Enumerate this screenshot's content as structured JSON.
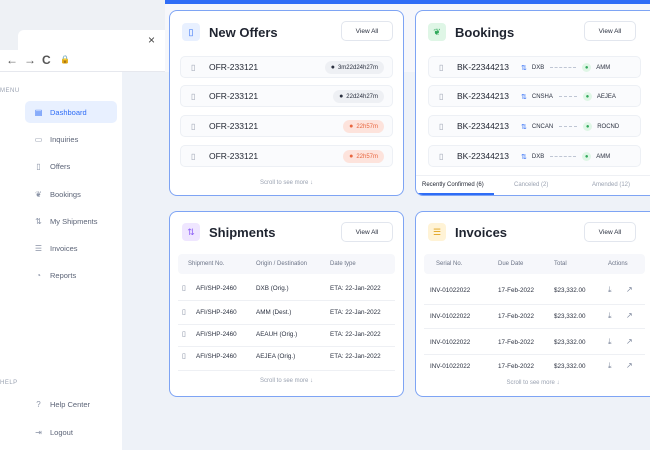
{
  "browser": {
    "tab_close": "×",
    "back": "←",
    "forward": "→",
    "reload": "C",
    "lock": "🔒"
  },
  "sidebar": {
    "menu_label": "MENU",
    "help_label": "HELP",
    "items": [
      {
        "label": "Dashboard",
        "icon": "dashboard-icon",
        "active": true
      },
      {
        "label": "Inquiries",
        "icon": "chat-icon",
        "active": false
      },
      {
        "label": "Offers",
        "icon": "document-icon",
        "active": false
      },
      {
        "label": "Bookings",
        "icon": "leaf-icon",
        "active": false
      },
      {
        "label": "My Shipments",
        "icon": "transfer-icon",
        "active": false
      },
      {
        "label": "Invoices",
        "icon": "list-icon",
        "active": false
      },
      {
        "label": "Reports",
        "icon": "pie-chart-icon",
        "active": false
      }
    ],
    "help_items": [
      {
        "label": "Help Center",
        "icon": "help-icon"
      },
      {
        "label": "Logout",
        "icon": "logout-icon"
      }
    ]
  },
  "offers": {
    "title": "New Offers",
    "view_all": "View All",
    "scroll_more": "Scroll to see more",
    "rows": [
      {
        "id": "OFR-233121",
        "timer": "3m22d24h27m",
        "urgent": false
      },
      {
        "id": "OFR-233121",
        "timer": "22d24h27m",
        "urgent": false
      },
      {
        "id": "OFR-233121",
        "timer": "22h57m",
        "urgent": true
      },
      {
        "id": "OFR-233121",
        "timer": "22h57m",
        "urgent": true
      }
    ]
  },
  "bookings": {
    "title": "Bookings",
    "view_all": "View All",
    "rows": [
      {
        "id": "BK-22344213",
        "from": "DXB",
        "to": "AMM"
      },
      {
        "id": "BK-22344213",
        "from": "CNSHA",
        "to": "AEJEA"
      },
      {
        "id": "BK-22344213",
        "from": "CNCAN",
        "to": "ROCND"
      },
      {
        "id": "BK-22344213",
        "from": "DXB",
        "to": "AMM"
      }
    ],
    "tabs": [
      "Recently Confirmed (6)",
      "Canceled (2)",
      "Amended (12)"
    ]
  },
  "shipments": {
    "title": "Shipments",
    "view_all": "View All",
    "scroll_more": "Scroll to see more",
    "headers": [
      "Shipment No.",
      "Origin / Destination",
      "Date type"
    ],
    "rows": [
      [
        "AFI/SHP-2460",
        "DXB (Orig.)",
        "ETA: 22-Jan-2022"
      ],
      [
        "AFI/SHP-2460",
        "AMM (Dest.)",
        "ETA: 22-Jan-2022"
      ],
      [
        "AFI/SHP-2460",
        "AEAUH (Orig.)",
        "ETA: 22-Jan-2022"
      ],
      [
        "AFI/SHP-2460",
        "AEJEA (Orig.)",
        "ETA: 22-Jan-2022"
      ]
    ]
  },
  "invoices": {
    "title": "Invoices",
    "view_all": "View All",
    "scroll_more": "Scroll to see more",
    "headers": [
      "Serial No.",
      "Due Date",
      "Total",
      "Actions"
    ],
    "rows": [
      [
        "INV-01022022",
        "17-Feb-2022",
        "$23,332.00"
      ],
      [
        "INV-01022022",
        "17-Feb-2022",
        "$23,332.00"
      ],
      [
        "INV-01022022",
        "17-Feb-2022",
        "$23,332.00"
      ],
      [
        "INV-01022022",
        "17-Feb-2022",
        "$23,332.00"
      ]
    ]
  },
  "colors": {
    "accent": "#2f6df6",
    "warn": "#e8663f",
    "success": "#2fa85a"
  }
}
